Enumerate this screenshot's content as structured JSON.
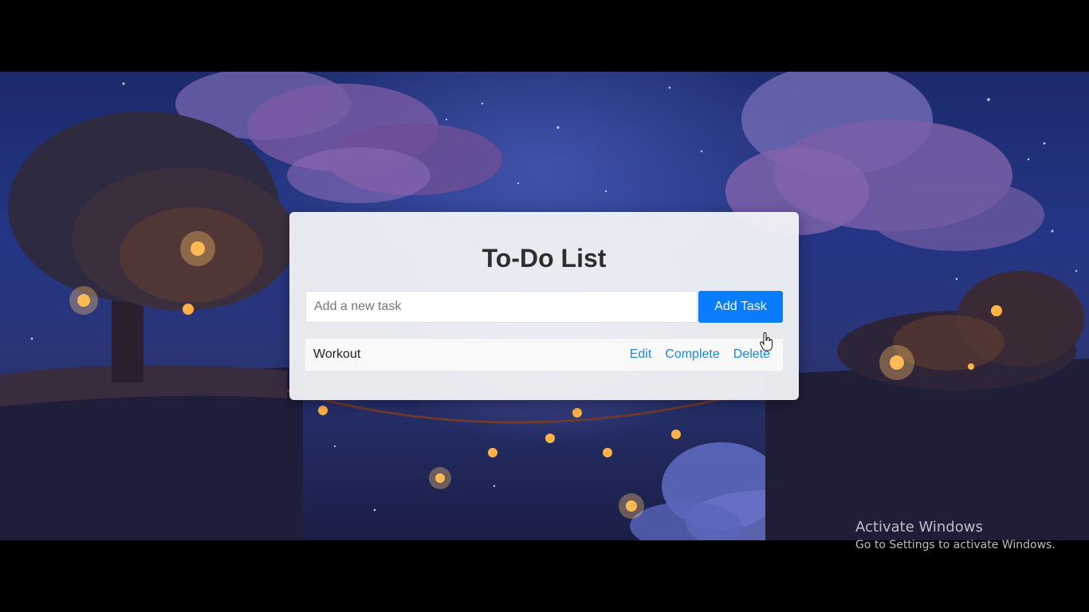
{
  "app": {
    "title": "To-Do List"
  },
  "input": {
    "placeholder": "Add a new task",
    "value": ""
  },
  "add_button": {
    "label": "Add Task"
  },
  "tasks": [
    {
      "text": "Workout",
      "actions": {
        "edit": "Edit",
        "complete": "Complete",
        "delete": "Delete"
      }
    }
  ],
  "watermark": {
    "title": "Activate Windows",
    "subtitle": "Go to Settings to activate Windows."
  },
  "colors": {
    "accent": "#0a7cff",
    "link": "#1e88d8",
    "card": "#f4f5f8",
    "title": "#2e2e2e"
  },
  "icons": {
    "cursor": "hand-pointer-cursor-icon"
  }
}
